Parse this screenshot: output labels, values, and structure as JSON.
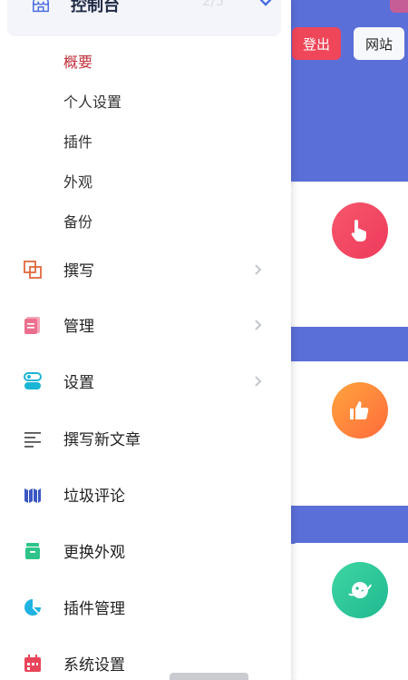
{
  "header": {
    "logout_label": "登出",
    "site_label": "网站"
  },
  "drawer": {
    "group": {
      "label": "控制台",
      "count": "2/5",
      "sub_items": [
        {
          "label": "概要",
          "active": true
        },
        {
          "label": "个人设置"
        },
        {
          "label": "插件"
        },
        {
          "label": "外观"
        },
        {
          "label": "备份"
        }
      ]
    },
    "items": [
      {
        "label": "撰写",
        "icon": "write-icon"
      },
      {
        "label": "管理",
        "icon": "manage-icon"
      },
      {
        "label": "设置",
        "icon": "settings-icon"
      },
      {
        "label": "撰写新文章",
        "icon": "new-post-icon"
      },
      {
        "label": "垃圾评论",
        "icon": "spam-icon"
      },
      {
        "label": "更换外观",
        "icon": "theme-icon"
      },
      {
        "label": "插件管理",
        "icon": "plugin-manage-icon"
      },
      {
        "label": "系统设置",
        "icon": "system-settings-icon"
      }
    ]
  },
  "colors": {
    "accent_blue": "#5a6fd8",
    "logout_red": "#f0465a",
    "active_text": "#c0313b"
  }
}
